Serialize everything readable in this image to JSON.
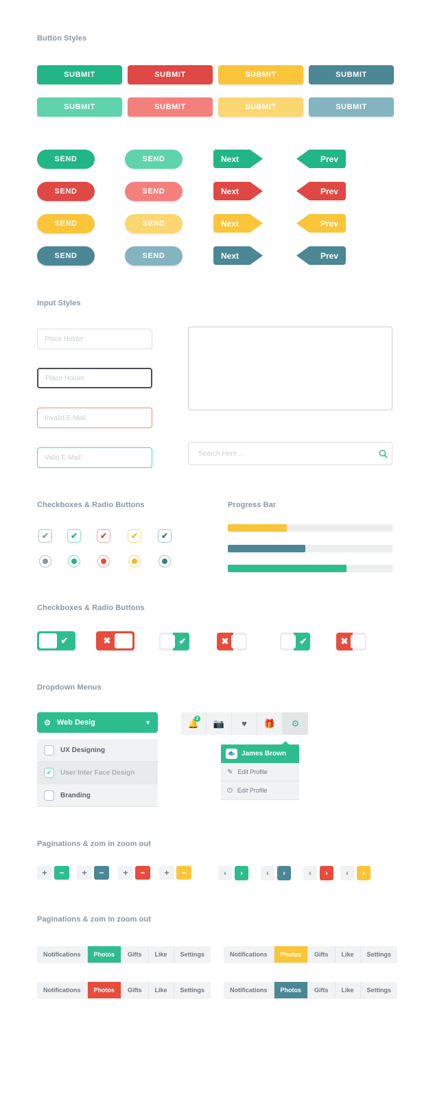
{
  "sections": {
    "button_styles": "Button Styles",
    "input_styles": "Input Styles",
    "checkboxes1": "Checkboxes & Radio Buttons",
    "progress": "Progress Bar",
    "checkboxes2": "Checkboxes & Radio Buttons",
    "dropdowns": "Dropdown Menus",
    "pagination1": "Paginations & zom in zoom out",
    "pagination2": "Paginations & zom in zoom out"
  },
  "colors": {
    "green": "#22b586",
    "green_light": "#5fd3ac",
    "red": "#df4844",
    "red_light": "#f4807d",
    "yellow": "#fbc53a",
    "yellow_light": "#fcd670",
    "teal": "#4b8795",
    "teal_light": "#83b4c0",
    "grey": "#8a98a5",
    "track": "#eceeef"
  },
  "submit_buttons": {
    "label": "SUBMIT",
    "rows": [
      [
        {
          "color": "#22b586",
          "tone": "solid"
        },
        {
          "color": "#df4844",
          "tone": "solid"
        },
        {
          "color": "#fbc53a",
          "tone": "solid"
        },
        {
          "color": "#4b8795",
          "tone": "solid"
        }
      ],
      [
        {
          "color": "#5fd3ac",
          "tone": "light"
        },
        {
          "color": "#f4807d",
          "tone": "light"
        },
        {
          "color": "#fcd670",
          "tone": "light"
        },
        {
          "color": "#83b4c0",
          "tone": "light"
        }
      ]
    ]
  },
  "send_buttons": {
    "label": "SEND",
    "rows": [
      [
        {
          "color": "#22b586"
        },
        {
          "color": "#5fd3ac"
        }
      ],
      [
        {
          "color": "#df4844"
        },
        {
          "color": "#f4807d"
        }
      ],
      [
        {
          "color": "#fbc53a"
        },
        {
          "color": "#fcd670"
        }
      ],
      [
        {
          "color": "#4b8795"
        },
        {
          "color": "#83b4c0"
        }
      ]
    ]
  },
  "arrow_buttons": {
    "next_label": "Next",
    "prev_label": "Prev",
    "rows": [
      {
        "color": "#22b586"
      },
      {
        "color": "#df4844"
      },
      {
        "color": "#fbc53a"
      },
      {
        "color": "#4b8795"
      }
    ]
  },
  "inputs": {
    "placeholder_default": "Place Holder",
    "placeholder_focus": "Place Holder",
    "placeholder_invalid": "Invalid E-Mail",
    "placeholder_valid": "Valid E-Mail",
    "textarea_value": "",
    "search_placeholder": "Search Here ...",
    "search_icon": "search-icon"
  },
  "checkboxes": {
    "check_glyph": "✔",
    "items": [
      {
        "border": "#b9c0c6",
        "tick": "#8a98a5"
      },
      {
        "border": "#7fdcbb",
        "tick": "#22b586"
      },
      {
        "border": "#f4a2a0",
        "tick": "#e74c3c"
      },
      {
        "border": "#fbd87c",
        "tick": "#f5b81f"
      },
      {
        "border": "#a7c3cb",
        "tick": "#3d7c8a"
      }
    ]
  },
  "radios": {
    "items": [
      {
        "border": "#b9c0c6",
        "dot": "#8a98a5"
      },
      {
        "border": "#7fdcbb",
        "dot": "#22b586"
      },
      {
        "border": "#f4a2a0",
        "dot": "#e74c3c"
      },
      {
        "border": "#fbd87c",
        "dot": "#f5b81f"
      },
      {
        "border": "#a7c3cb",
        "dot": "#3d7c8a"
      }
    ]
  },
  "progress_bars": [
    {
      "percent": 36,
      "color": "#fbc53a"
    },
    {
      "percent": 47,
      "color": "#4b8795"
    },
    {
      "percent": 72,
      "color": "#2ebd8e"
    }
  ],
  "toggles": [
    {
      "state": "on",
      "color": "#2ebd8e",
      "glyph": "✔",
      "size": "lg",
      "track": "#2ebd8e"
    },
    {
      "state": "off",
      "color": "#e74c3c",
      "glyph": "✖",
      "size": "lg",
      "track": "#e74c3c"
    },
    {
      "state": "on",
      "color": "#2ebd8e",
      "glyph": "✔",
      "size": "sm",
      "track": "#ececec"
    },
    {
      "state": "off",
      "color": "#e74c3c",
      "glyph": "✖",
      "size": "sm",
      "track": "#ececec"
    },
    {
      "state": "on",
      "color": "#2ebd8e",
      "glyph": "✔",
      "size": "sm",
      "track": "#ececec"
    },
    {
      "state": "off",
      "color": "#e74c3c",
      "glyph": "✖",
      "size": "sm",
      "track": "#ececec"
    }
  ],
  "dropdown": {
    "header_label": "Web Desig",
    "header_icon": "gear-icon",
    "caret_icon": "chevron-down-icon",
    "items": [
      {
        "label": "UX Designing",
        "checked": false
      },
      {
        "label": "User Inter Face Design",
        "checked": true
      },
      {
        "label": "Branding",
        "checked": false
      }
    ]
  },
  "icon_bar": {
    "icons": [
      {
        "name": "bell-icon",
        "glyph": "🔔",
        "badge": "2"
      },
      {
        "name": "camera-icon",
        "glyph": "📷",
        "badge": ""
      },
      {
        "name": "heart-icon",
        "glyph": "♥",
        "badge": ""
      },
      {
        "name": "gift-icon",
        "glyph": "🎁",
        "badge": ""
      },
      {
        "name": "gear-icon",
        "glyph": "⚙",
        "badge": ""
      }
    ]
  },
  "user_menu": {
    "name": "James Brown",
    "avatar_icon": "avatar-icon",
    "items": [
      {
        "label": "Edit Profile",
        "icon": "edit-icon"
      },
      {
        "label": "Edit Profile",
        "icon": "power-icon"
      }
    ]
  },
  "zoom_controls": [
    {
      "plus": "+",
      "minus": "−",
      "color": "#2ebd8e"
    },
    {
      "plus": "+",
      "minus": "−",
      "color": "#4b8795"
    },
    {
      "plus": "+",
      "minus": "−",
      "color": "#e74c3c"
    },
    {
      "plus": "+",
      "minus": "−",
      "color": "#fbc53a"
    }
  ],
  "page_controls": [
    {
      "prev": "‹",
      "next": "›",
      "color": "#2ebd8e"
    },
    {
      "prev": "‹",
      "next": "›",
      "color": "#4b8795"
    },
    {
      "prev": "‹",
      "next": "›",
      "color": "#e74c3c"
    },
    {
      "prev": "‹",
      "next": "›",
      "color": "#fbc53a"
    }
  ],
  "tab_bars": [
    {
      "active_color": "#2ebd8e",
      "active_index": 1,
      "tabs": [
        "Notifications",
        "Photos",
        "Gifts",
        "Like",
        "Settings"
      ]
    },
    {
      "active_color": "#fbc53a",
      "active_index": 1,
      "tabs": [
        "Notifications",
        "Photos",
        "Gifts",
        "Like",
        "Settings"
      ]
    },
    {
      "active_color": "#e74c3c",
      "active_index": 1,
      "tabs": [
        "Notifications",
        "Photos",
        "Gifts",
        "Like",
        "Settings"
      ]
    },
    {
      "active_color": "#4b8795",
      "active_index": 1,
      "tabs": [
        "Notifications",
        "Photos",
        "Gifts",
        "Like",
        "Settings"
      ]
    }
  ]
}
